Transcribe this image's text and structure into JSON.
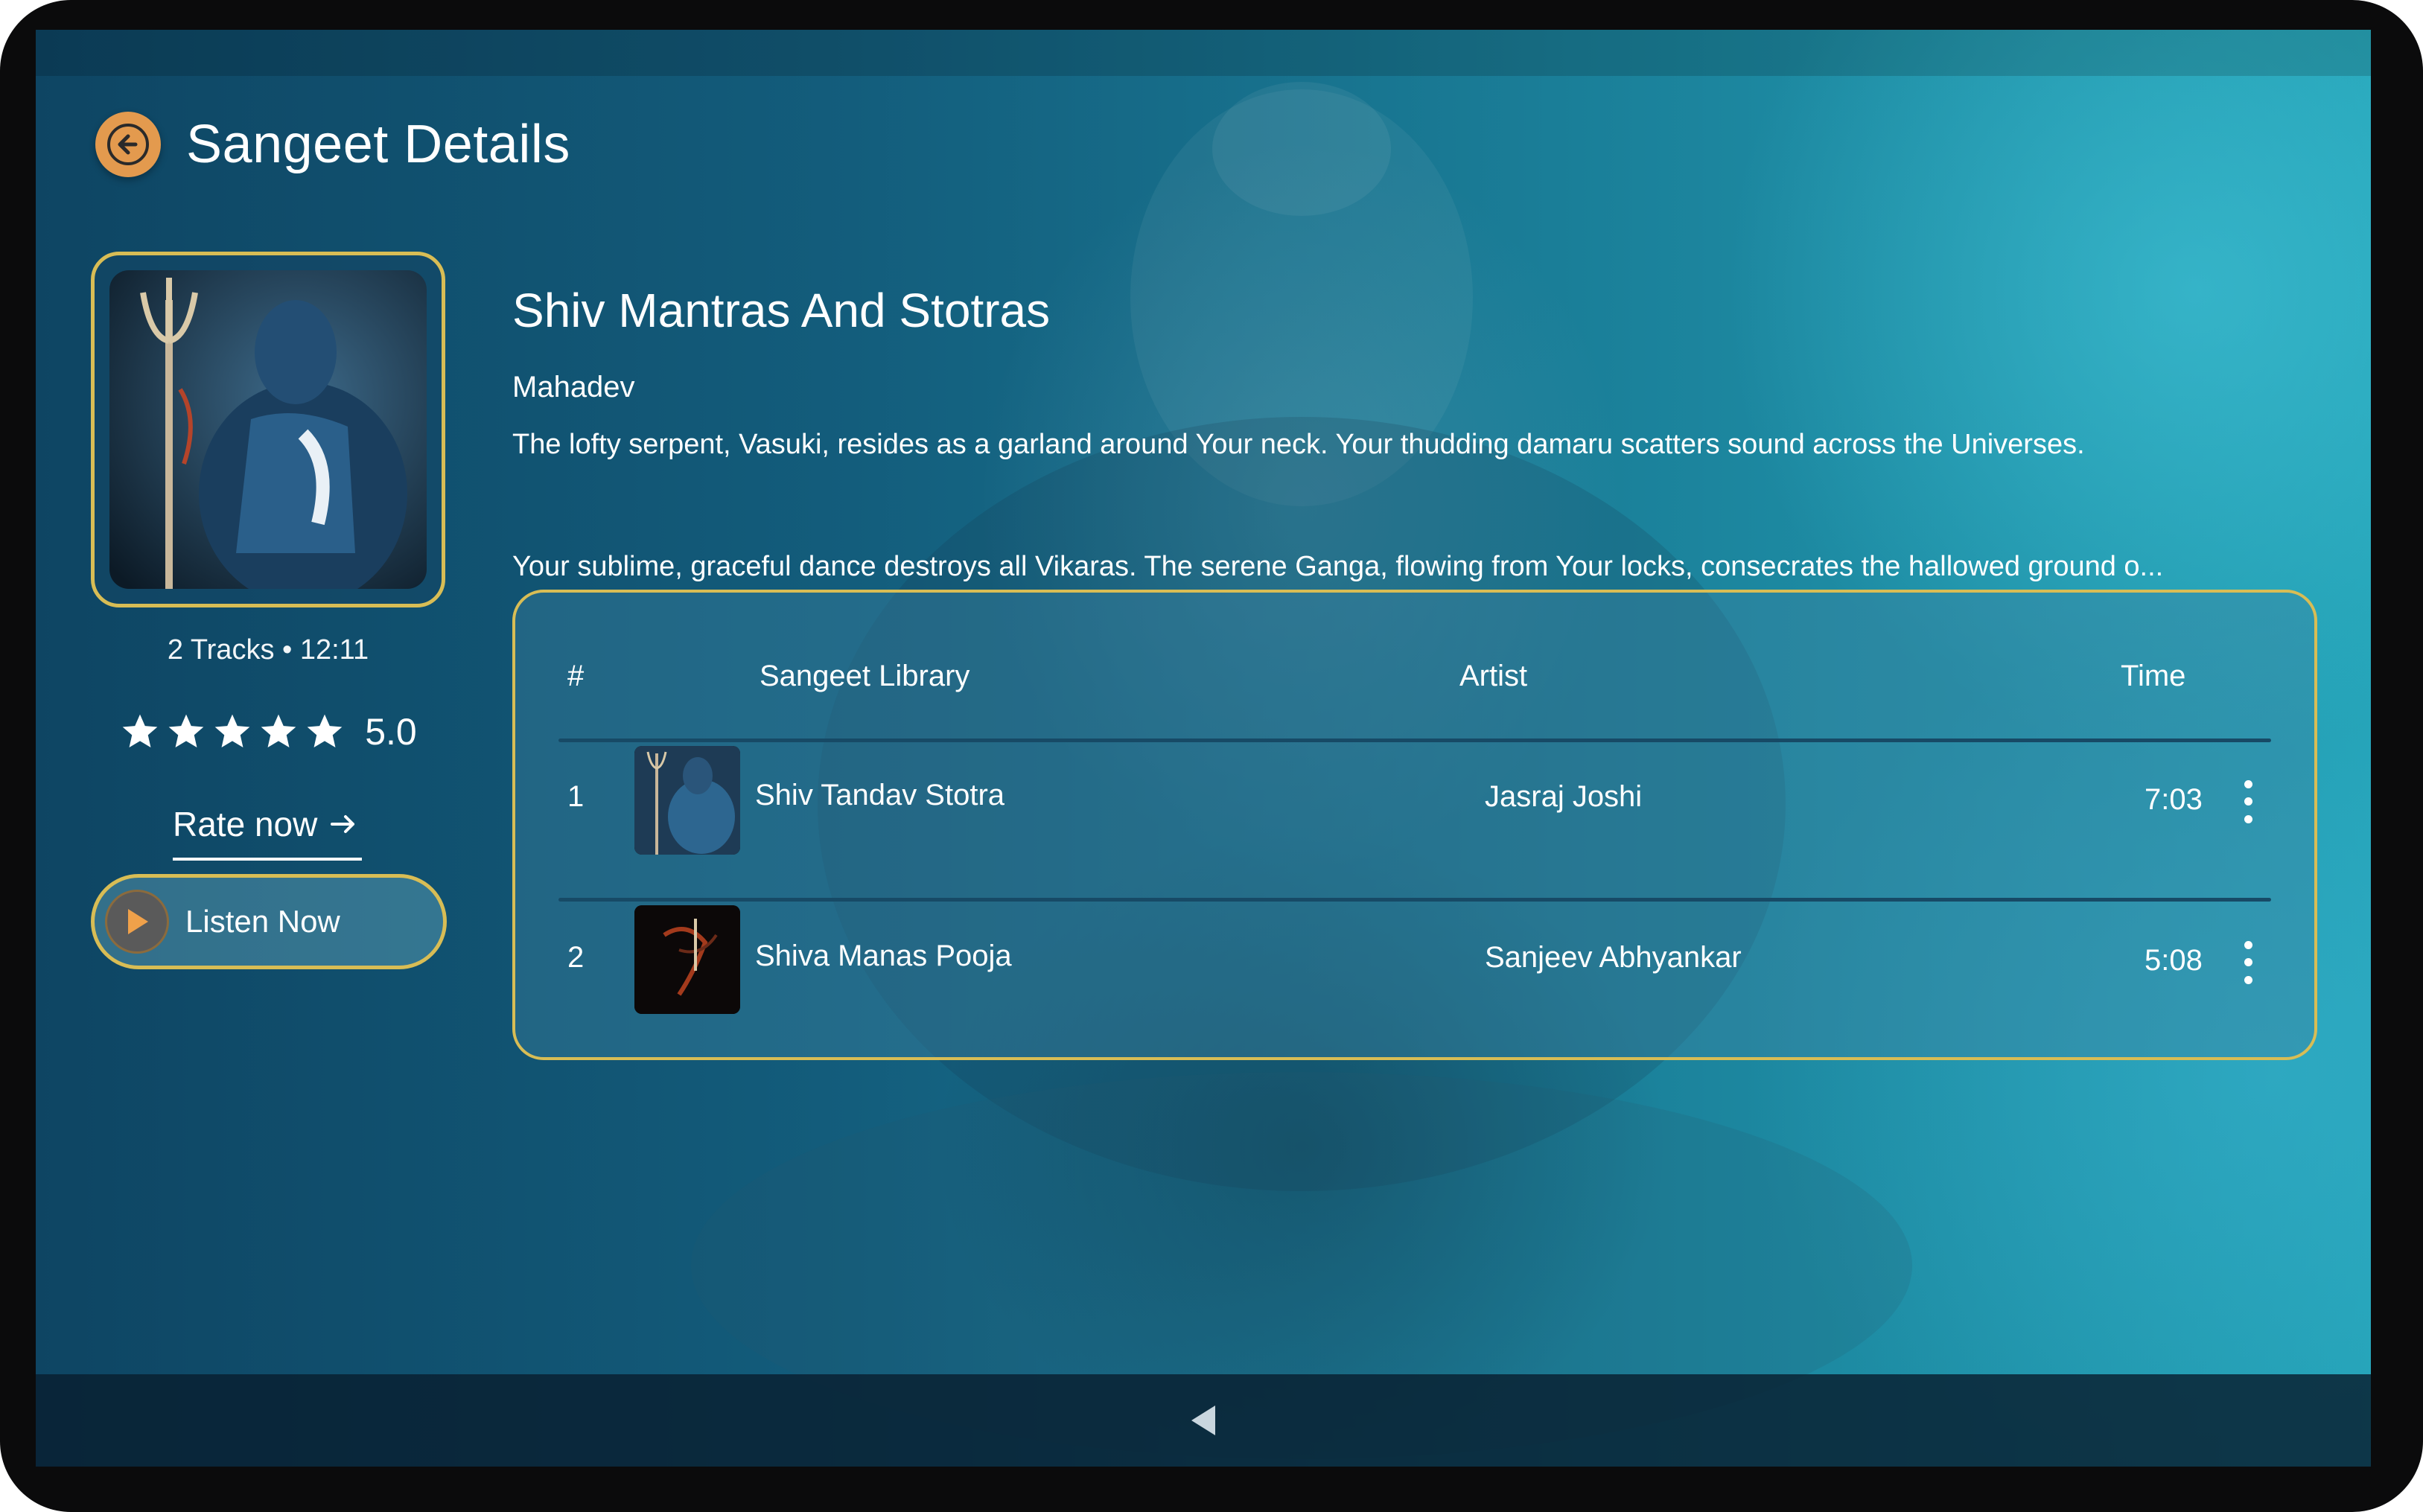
{
  "header": {
    "title": "Sangeet Details"
  },
  "album": {
    "title": "Shiv Mantras And Stotras",
    "subtitle": "Mahadev",
    "description_line1": "The lofty serpent, Vasuki, resides as a garland around Your neck. Your thudding damaru scatters sound across the Universes.",
    "description_line2": "Your sublime, graceful dance destroys all Vikaras. The serene Ganga, flowing from Your locks, consecrates the hallowed ground o...",
    "meta": "2 Tracks • 12:11",
    "rating": "5.0",
    "rating_stars": 5,
    "rate_now_label": "Rate now",
    "listen_now_label": "Listen Now"
  },
  "tracks_table": {
    "headers": {
      "index": "#",
      "title": "Sangeet Library",
      "artist": "Artist",
      "time": "Time"
    },
    "rows": [
      {
        "index": "1",
        "title": "Shiv Tandav Stotra",
        "artist": "Jasraj Joshi",
        "time": "7:03"
      },
      {
        "index": "2",
        "title": "Shiva Manas Pooja",
        "artist": "Sanjeev Abhyankar",
        "time": "5:08"
      }
    ]
  },
  "icons": {
    "back": "arrow-left-icon",
    "star": "star-icon",
    "rate_arrow": "arrow-right-icon",
    "play": "play-icon",
    "more": "more-vertical-icon",
    "nav_back": "nav-back-icon"
  },
  "colors": {
    "accent_gold": "#d8bd55",
    "back_button": "#e39a4e",
    "background_dark": "#0e4563",
    "background_light": "#23a2b6"
  }
}
